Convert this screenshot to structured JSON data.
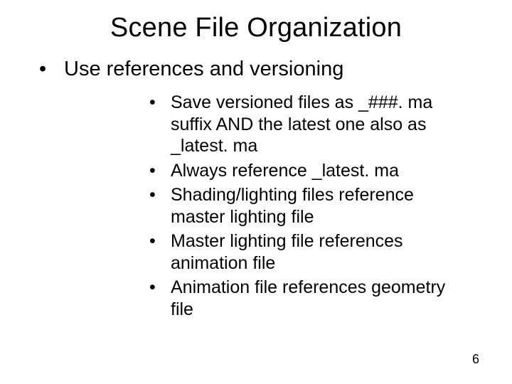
{
  "title": "Scene File Organization",
  "bullets": {
    "lvl1": [
      {
        "text": "Use references and versioning",
        "children": [
          "Save versioned files as _###. ma suffix AND the latest one also as _latest. ma",
          "Always reference _latest. ma",
          "Shading/lighting files reference master lighting file",
          "Master lighting file references animation file",
          "Animation file references geometry file"
        ]
      }
    ]
  },
  "page_number": "6"
}
